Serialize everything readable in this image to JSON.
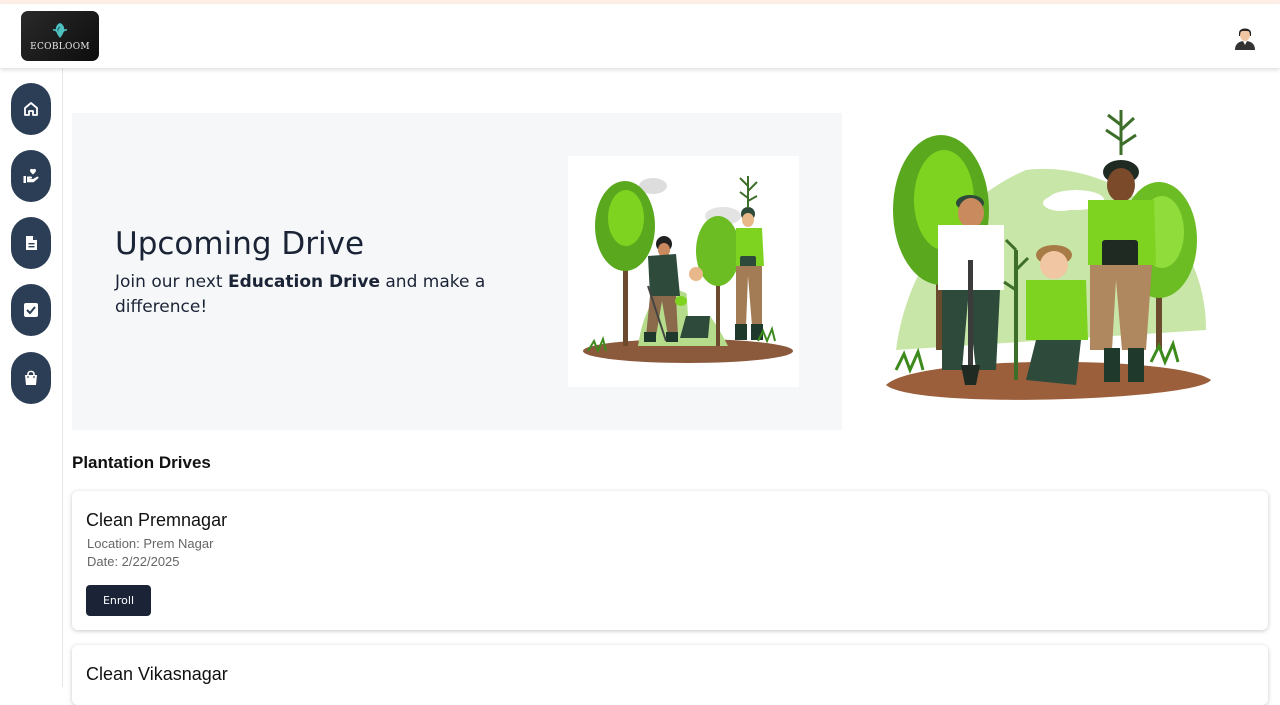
{
  "header": {
    "logo_text": "ECOBLOOM"
  },
  "sidebar": {
    "items": [
      {
        "name": "home",
        "icon": "home-icon"
      },
      {
        "name": "donate",
        "icon": "hand-heart-icon"
      },
      {
        "name": "documents",
        "icon": "document-icon"
      },
      {
        "name": "tasks",
        "icon": "checkbox-icon"
      },
      {
        "name": "shop",
        "icon": "shopping-bag-icon"
      }
    ]
  },
  "hero": {
    "title": "Upcoming Drive",
    "subtitle_pre": "Join our next ",
    "subtitle_bold": "Education Drive",
    "subtitle_post": " and make a difference!"
  },
  "section": {
    "title": "Plantation Drives"
  },
  "drives": [
    {
      "title": "Clean Premnagar",
      "location": "Location: Prem Nagar",
      "date": "Date: 2/22/2025",
      "button": "Enroll"
    },
    {
      "title": "Clean Vikasnagar"
    }
  ],
  "colors": {
    "accent": "#1b2436",
    "sidebar_button": "#2c3e56",
    "hero_bg": "#f6f7f9",
    "plant_green": "#7ed321"
  }
}
